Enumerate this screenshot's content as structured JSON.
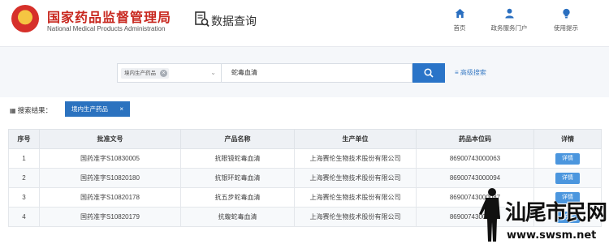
{
  "header": {
    "org_name": "国家药品监督管理局",
    "org_name_en": "National Medical Products Administration",
    "section_title": "数据查询",
    "nav": [
      {
        "label": "首页",
        "icon": "home-icon"
      },
      {
        "label": "政务服务门户",
        "icon": "user-icon"
      },
      {
        "label": "使用提示",
        "icon": "lightbulb-icon"
      }
    ]
  },
  "search": {
    "category_tag": "境内生产药品",
    "keyword": "蛇毒血清",
    "advanced_label": "高级搜索"
  },
  "results": {
    "label": "搜索结果：",
    "chip": "境内生产药品"
  },
  "table": {
    "columns": [
      "序号",
      "批准文号",
      "产品名称",
      "生产单位",
      "药品本位码",
      "详情"
    ],
    "rows": [
      [
        "1",
        "国药准字S10830005",
        "抗眼镜蛇毒血清",
        "上海赛伦生物技术股份有限公司",
        "86900743000063",
        "详情"
      ],
      [
        "2",
        "国药准字S10820180",
        "抗银环蛇毒血清",
        "上海赛伦生物技术股份有限公司",
        "86900743000094",
        "详情"
      ],
      [
        "3",
        "国药准字S10820178",
        "抗五步蛇毒血清",
        "上海赛伦生物技术股份有限公司",
        "86900743000087",
        "详情"
      ],
      [
        "4",
        "国药准字S10820179",
        "抗蝮蛇毒血清",
        "上海赛伦生物技术股份有限公司",
        "86900743000070",
        "详情"
      ]
    ]
  },
  "watermark": {
    "text": "汕尾市民网",
    "url": "www.swsm.net"
  },
  "colors": {
    "brand_red": "#c8281f",
    "primary_blue": "#2a74c8",
    "detail_blue": "#4b96de",
    "search_bg": "#f5f7fa"
  }
}
